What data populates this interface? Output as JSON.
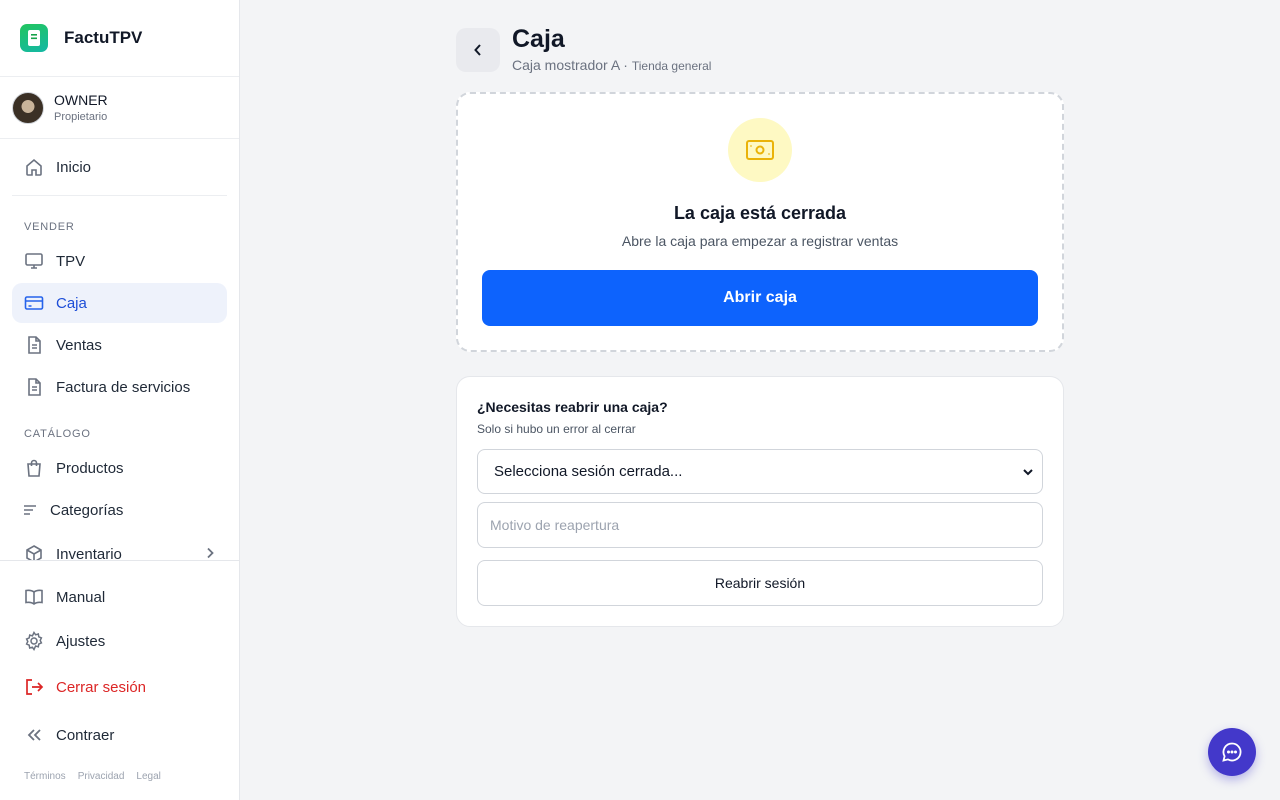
{
  "brand": {
    "name": "FactuTPV"
  },
  "user": {
    "name": "OWNER",
    "role": "Propietario"
  },
  "sidebar": {
    "home": {
      "label": "Inicio",
      "icon": "home-icon"
    },
    "sections": [
      {
        "title": "VENDER",
        "items": [
          {
            "label": "TPV",
            "icon": "monitor-icon"
          },
          {
            "label": "Caja",
            "icon": "credit-card-icon",
            "active": true
          },
          {
            "label": "Ventas",
            "icon": "document-icon"
          },
          {
            "label": "Factura de servicios",
            "icon": "document-icon"
          }
        ]
      },
      {
        "title": "CATÁLOGO",
        "items": [
          {
            "label": "Productos",
            "icon": "shopping-bag-icon"
          },
          {
            "label": "Categorías",
            "icon": "lines-icon"
          },
          {
            "label": "Inventario",
            "icon": "box-icon",
            "has_submenu": true
          }
        ]
      }
    ],
    "bottom": {
      "manual": "Manual",
      "settings": "Ajustes",
      "logout": "Cerrar sesión",
      "collapse": "Contraer"
    },
    "footer_links": [
      "Términos",
      "Privacidad",
      "Legal"
    ]
  },
  "header": {
    "title": "Caja",
    "register": "Caja mostrador A",
    "separator": " · ",
    "store": "Tienda general"
  },
  "closed_card": {
    "title": "La caja está cerrada",
    "subtitle": "Abre la caja para empezar a registrar ventas",
    "button": "Abrir caja"
  },
  "reopen_card": {
    "title": "¿Necesitas reabrir una caja?",
    "subtitle": "Solo si hubo un error al cerrar",
    "select_value": "Selecciona sesión cerrada...",
    "reason_placeholder": "Motivo de reapertura",
    "button": "Reabrir sesión"
  },
  "colors": {
    "primary": "#0d63fd",
    "active_nav_bg": "#eef2fb",
    "danger": "#dc2626",
    "chat": "#4338ca",
    "brand_green": "#22c55e",
    "closed_icon_bg": "#fef9c3",
    "closed_icon": "#eab308"
  }
}
